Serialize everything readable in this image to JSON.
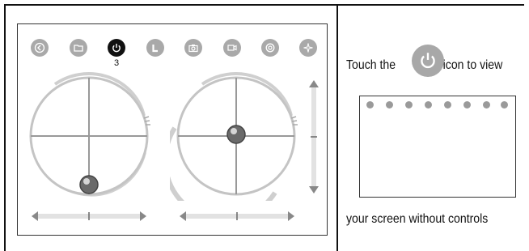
{
  "controls": {
    "icons": [
      {
        "name": "back-icon"
      },
      {
        "name": "folder-icon"
      },
      {
        "name": "power-icon",
        "active": true
      },
      {
        "name": "l-mode-icon"
      },
      {
        "name": "camera-icon"
      },
      {
        "name": "video-icon"
      },
      {
        "name": "settings-icon"
      },
      {
        "name": "compass-icon"
      }
    ],
    "active_callout": "3"
  },
  "instructions": {
    "line1_before": "Touch the",
    "line1_after": "icon to view",
    "line2": "your screen without controls"
  },
  "colors": {
    "icon_gray": "#a9a9a9",
    "icon_active": "#111111",
    "frame": "#333333"
  }
}
